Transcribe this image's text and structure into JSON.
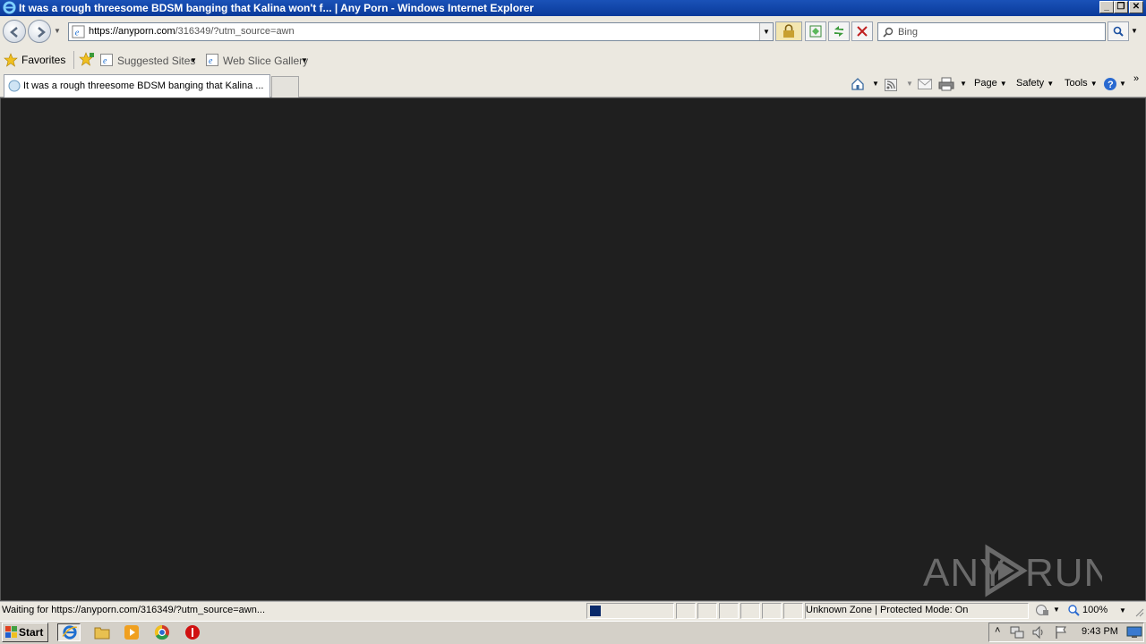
{
  "window": {
    "title": "It was a rough threesome BDSM banging that Kalina won't f... | Any Porn - Windows Internet Explorer",
    "controls": [
      "minimize",
      "restore",
      "close"
    ]
  },
  "address_bar": {
    "url_host": "https://anyporn.com",
    "url_rest": "/316349/?utm_source=awn"
  },
  "search": {
    "placeholder": "Bing"
  },
  "favorites_bar": {
    "favorites_label": "Favorites",
    "items": [
      "Suggested Sites",
      "Web Slice Gallery"
    ]
  },
  "tabs": [
    {
      "label": "It was a rough threesome BDSM banging that Kalina ..."
    }
  ],
  "command_bar": {
    "page": "Page",
    "safety": "Safety",
    "tools": "Tools"
  },
  "watermark": "ANY RUN",
  "status_bar": {
    "text": "Waiting for https://anyporn.com/316349/?utm_source=awn...",
    "zone": "Unknown Zone | Protected Mode: On",
    "zoom": "100%"
  },
  "taskbar": {
    "start_label": "Start",
    "clock": "9:43 PM"
  },
  "colors": {
    "title_bar": "#0a3a9a",
    "content_bg": "#1f1f1f",
    "chrome": "#ebe8e0"
  }
}
